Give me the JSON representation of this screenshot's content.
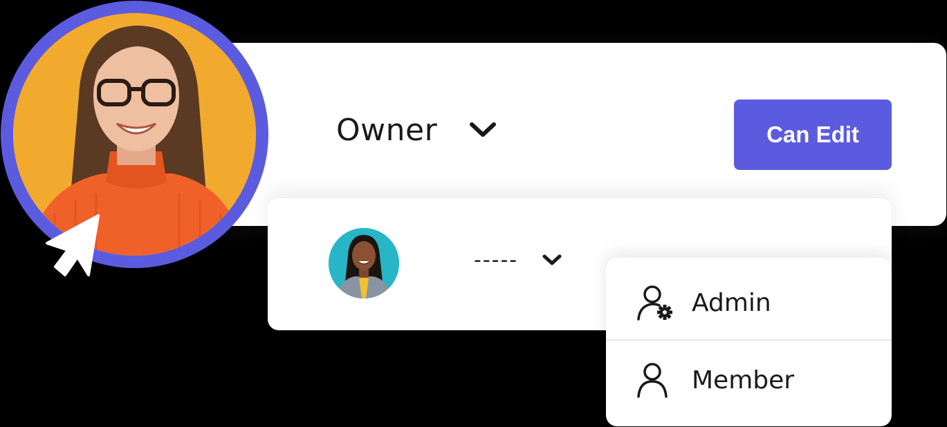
{
  "owner_card": {
    "role_label": "Owner",
    "permission_button": "Can Edit"
  },
  "member_card": {
    "role_label": "-----"
  },
  "dropdown": {
    "items": [
      {
        "label": "Admin",
        "icon": "user-gear-icon"
      },
      {
        "label": "Member",
        "icon": "user-icon"
      }
    ]
  },
  "colors": {
    "accent": "#5b5bdf",
    "owner_avatar_bg": "#f2aa2e",
    "member_avatar_bg": "#27b6c7"
  }
}
